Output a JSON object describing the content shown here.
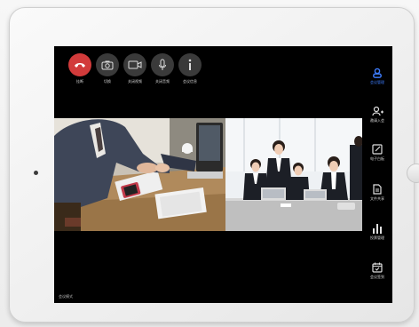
{
  "toolbar": [
    {
      "label": "挂断",
      "icon": "phone-hangup-icon"
    },
    {
      "label": "切换",
      "icon": "camera-switch-icon"
    },
    {
      "label": "关闭视频",
      "icon": "video-icon"
    },
    {
      "label": "关闭音频",
      "icon": "microphone-icon"
    },
    {
      "label": "会议信息",
      "icon": "info-icon"
    }
  ],
  "sidebar": [
    {
      "label": "会议管理",
      "icon": "people-icon",
      "active": true
    },
    {
      "label": "邀请入会",
      "icon": "add-person-icon"
    },
    {
      "label": "电子白板",
      "icon": "whiteboard-icon"
    },
    {
      "label": "文件共享",
      "icon": "file-share-icon"
    },
    {
      "label": "投票管理",
      "icon": "chart-icon"
    },
    {
      "label": "会议签到",
      "icon": "calendar-check-icon"
    }
  ],
  "videos": [
    {
      "tag": "",
      "scene": "business handshake at table"
    },
    {
      "tag": "",
      "scene": "team meeting around table"
    }
  ],
  "status_text": "会议模式",
  "colors": {
    "hangup": "#d23b3b",
    "accent": "#3e7dff",
    "screen": "#000000"
  }
}
